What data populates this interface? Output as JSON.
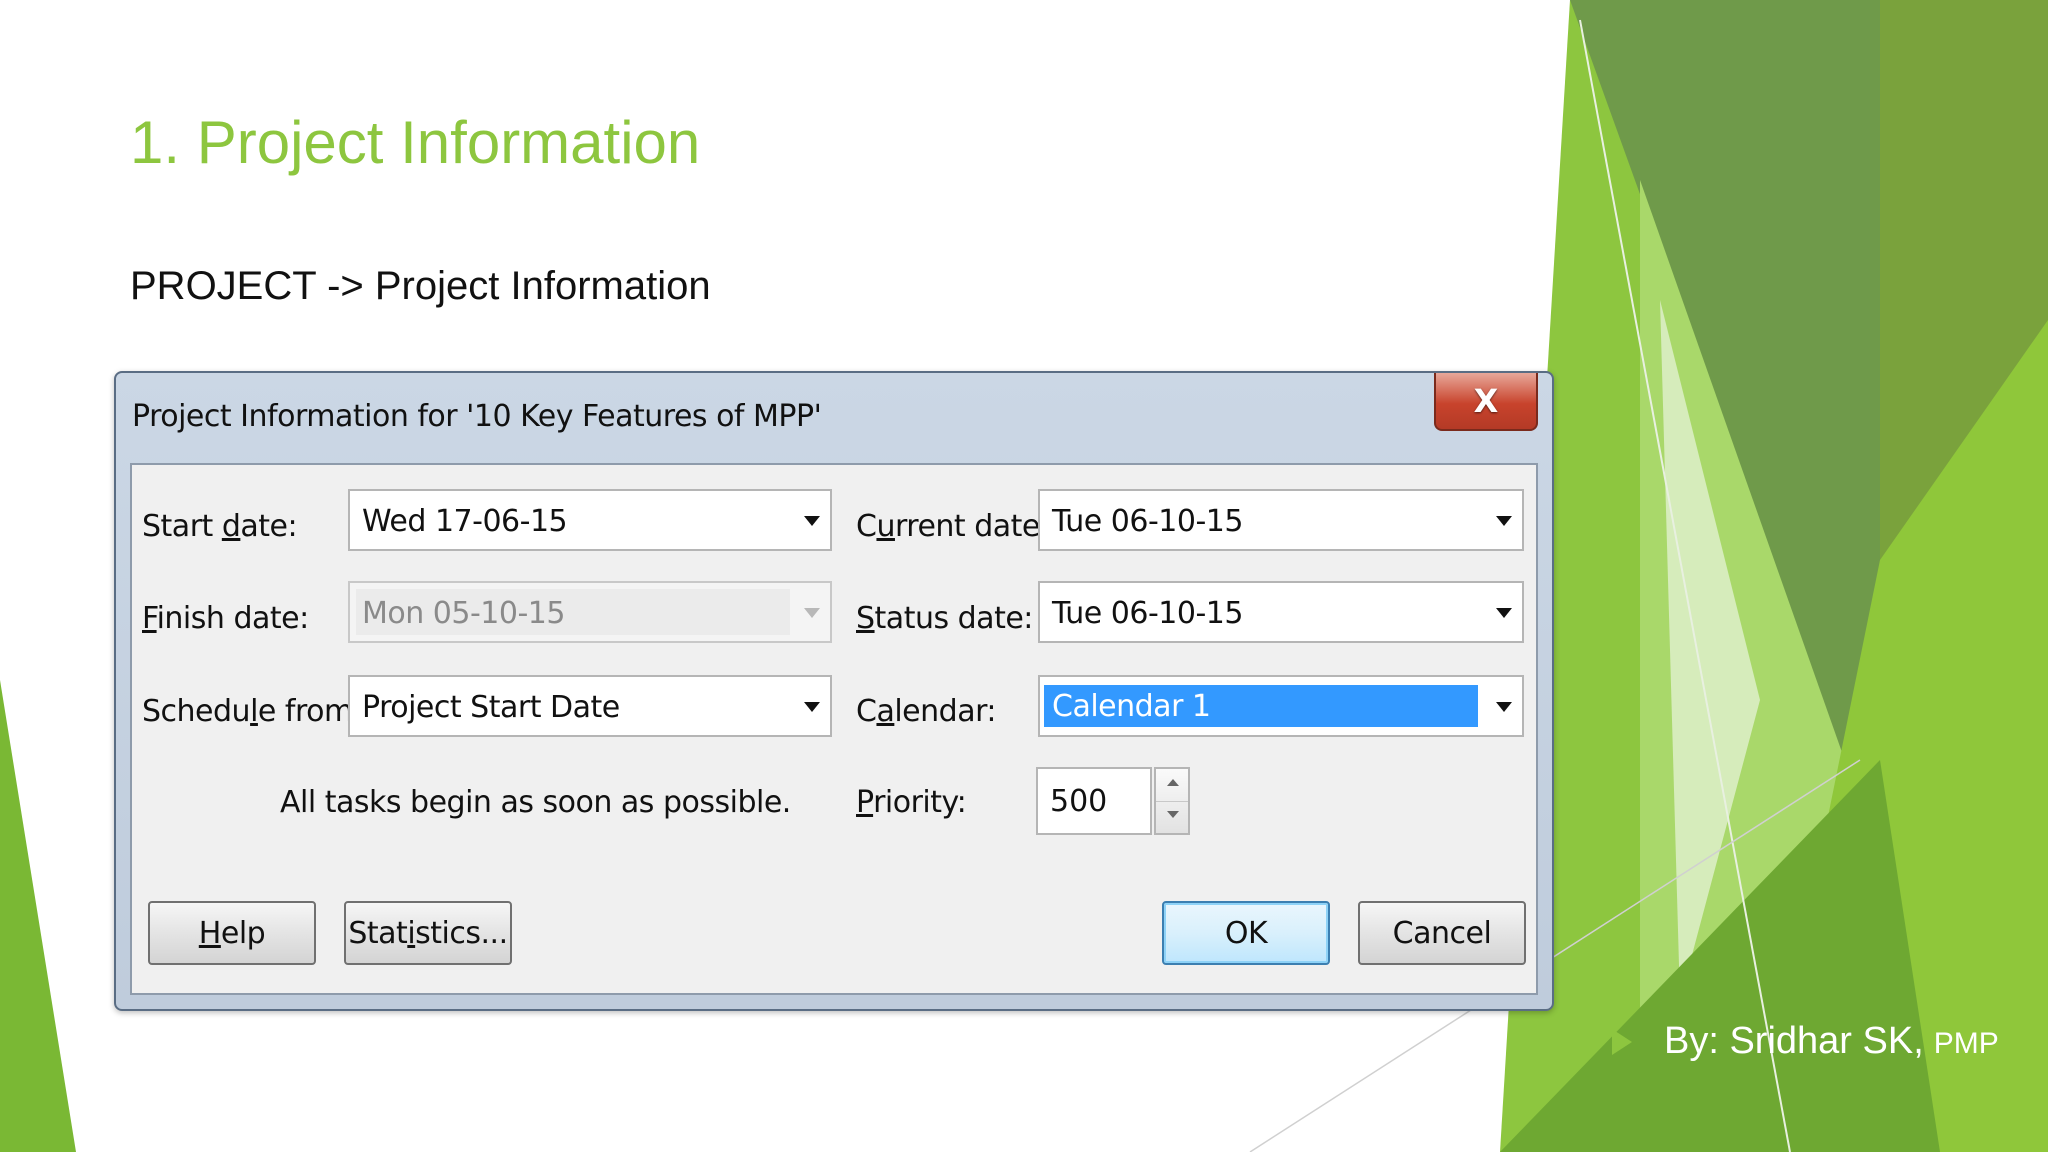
{
  "slide": {
    "title": "1. Project Information",
    "subtitle": "PROJECT -> Project Information",
    "byline_main": "By: Sridhar SK,",
    "byline_suffix": "PMP"
  },
  "dialog": {
    "title": "Project Information for '10 Key Features of MPP'",
    "close_label": "X",
    "start_date": {
      "label_pre": "Start ",
      "label_key": "d",
      "label_post": "ate:",
      "value": "Wed 17-06-15"
    },
    "finish_date": {
      "label_pre": "",
      "label_key": "F",
      "label_post": "inish date:",
      "value": "Mon 05-10-15"
    },
    "schedule_from": {
      "label_pre": "Schedu",
      "label_key": "l",
      "label_post": "e from:",
      "value": "Project Start Date"
    },
    "current_date": {
      "label_pre": "C",
      "label_key": "u",
      "label_post": "rrent date:",
      "value": "Tue 06-10-15"
    },
    "status_date": {
      "label_pre": "",
      "label_key": "S",
      "label_post": "tatus date:",
      "value": "Tue 06-10-15"
    },
    "calendar": {
      "label_pre": "C",
      "label_key": "a",
      "label_post": "lendar:",
      "value": "Calendar 1"
    },
    "priority": {
      "label_pre": "",
      "label_key": "P",
      "label_post": "riority:",
      "value": "500"
    },
    "note": "All tasks begin as soon as possible.",
    "buttons": {
      "help_key": "H",
      "help_rest": "elp",
      "statistics_pre": "Stat",
      "statistics_key": "i",
      "statistics_post": "stics...",
      "ok": "OK",
      "cancel": "Cancel"
    }
  },
  "colors": {
    "accent_green": "#8dc63f",
    "dialog_frame": "#bfccdc",
    "selection_blue": "#3399ff",
    "close_red": "#c8432c"
  }
}
